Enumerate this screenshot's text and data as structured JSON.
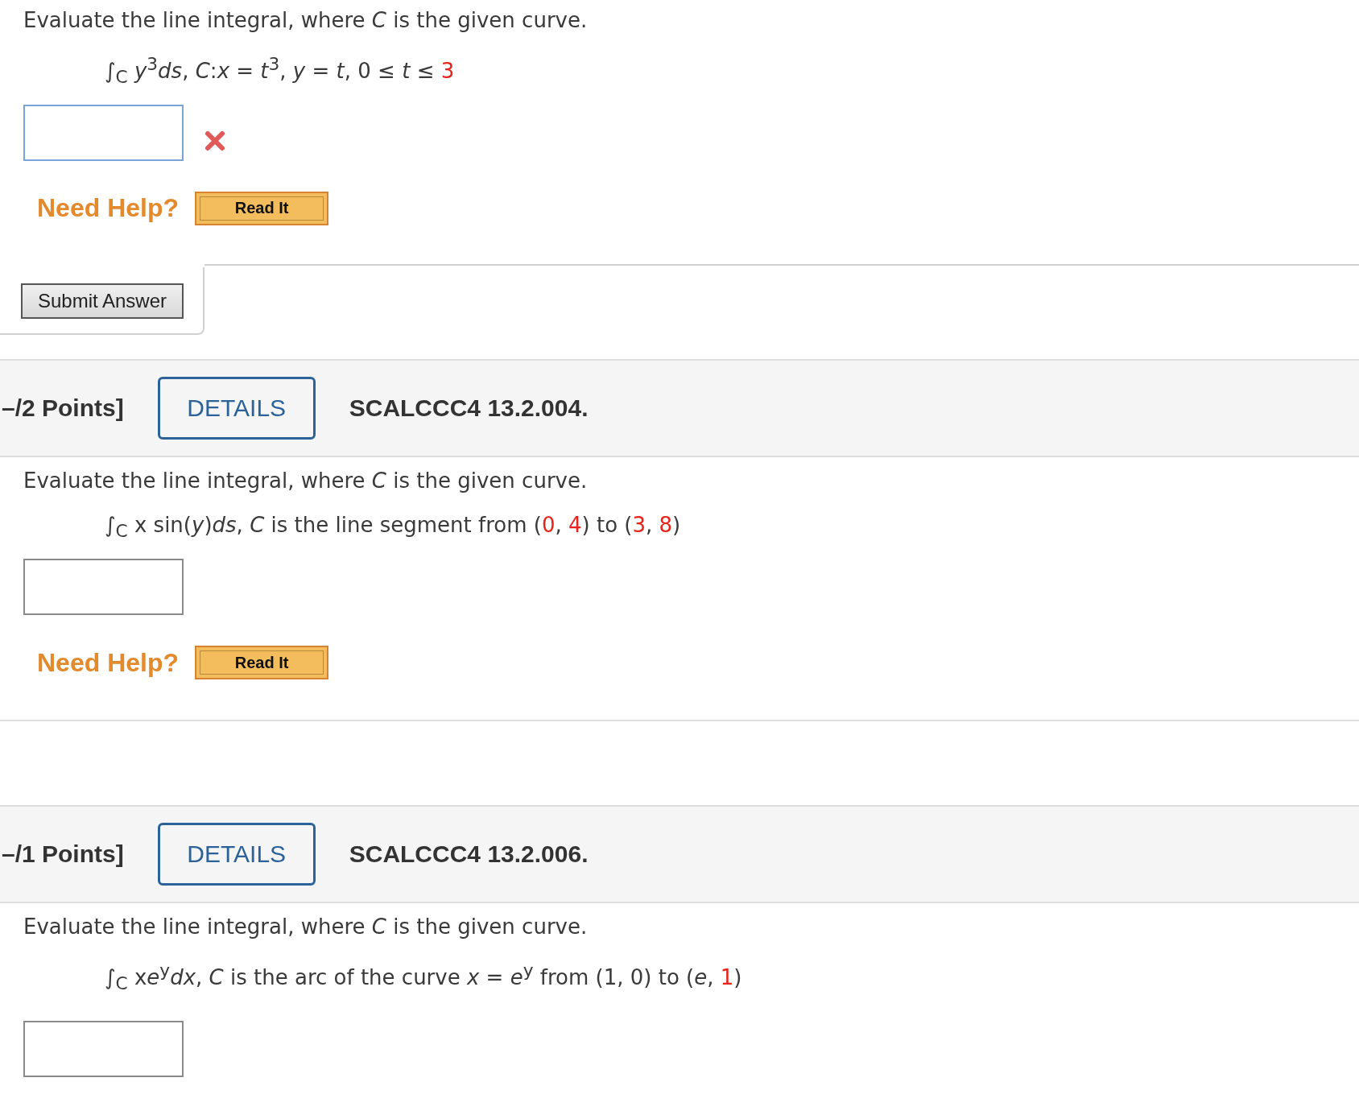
{
  "questions": [
    {
      "prompt": "Evaluate the line integral, where *C* is the given curve.",
      "formula": [
        {
          "text": "∫$_{C}$ *y*$^{3}$*ds*, *C*:*x* = *t*$^{3}$, *y* = *t*, 0 ≤ *t* ≤ "
        },
        {
          "text": "3",
          "color": "#e8231a"
        }
      ],
      "answer": {
        "focused": true,
        "incorrect": true
      },
      "help": {
        "label": "Need Help?",
        "button": "Read It"
      },
      "submit": "Submit Answer"
    },
    {
      "header": {
        "points": "–/2 Points]",
        "details": "DETAILS",
        "code": "SCALCCC4 13.2.004."
      },
      "prompt": "Evaluate the line integral, where *C* is the given curve.",
      "formula": [
        {
          "text": "∫$_{C}$ x sin(*y*)*ds*, *C* is the line segment from ("
        },
        {
          "text": "0",
          "color": "#e8231a"
        },
        {
          "text": ", "
        },
        {
          "text": "4",
          "color": "#e8231a"
        },
        {
          "text": ") to ("
        },
        {
          "text": "3",
          "color": "#e8231a"
        },
        {
          "text": ", "
        },
        {
          "text": "8",
          "color": "#e8231a"
        },
        {
          "text": ")"
        }
      ],
      "answer": {
        "focused": false,
        "incorrect": false
      },
      "help": {
        "label": "Need Help?",
        "button": "Read It"
      }
    },
    {
      "header": {
        "points": "–/1 Points]",
        "details": "DETAILS",
        "code": "SCALCCC4 13.2.006."
      },
      "prompt": "Evaluate the line integral, where *C* is the given curve.",
      "formula": [
        {
          "text": "∫$_{C}$ x"
        },
        {
          "text": "*e*$^{y}$*dx*, *C* is the arc of the curve *x* = *e*$^{y}$ from (1, 0) to (*e*, "
        },
        {
          "text": "1",
          "color": "#e8231a"
        },
        {
          "text": ")"
        }
      ],
      "answer": {
        "focused": false,
        "incorrect": false
      }
    }
  ]
}
